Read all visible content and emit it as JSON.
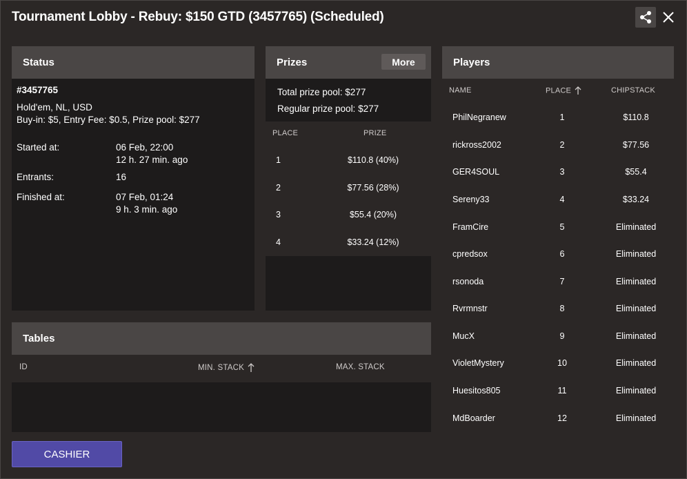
{
  "window": {
    "title": "Tournament Lobby - Rebuy: $150 GTD (3457765) (Scheduled)"
  },
  "icons": {
    "share": "share-icon",
    "close": "close-icon",
    "sort": "sort-arrow-up-icon"
  },
  "status": {
    "heading": "Status",
    "id": "#3457765",
    "game": "Hold'em, NL, USD",
    "buyin": "Buy-in: $5, Entry Fee: $0.5, Prize pool: $277",
    "started_label": "Started at:",
    "started_value": "06 Feb, 22:00",
    "started_ago": "12 h. 27 min. ago",
    "entrants_label": "Entrants:",
    "entrants_value": "16",
    "finished_label": "Finished at:",
    "finished_value": "07 Feb, 01:24",
    "finished_ago": "9 h. 3 min. ago"
  },
  "prizes": {
    "heading": "Prizes",
    "more_label": "More",
    "total_pool": "Total prize pool: $277",
    "regular_pool": "Regular prize pool: $277",
    "col_place": "PLACE",
    "col_prize": "PRIZE",
    "rows": [
      {
        "place": "1",
        "prize": "$110.8 (40%)"
      },
      {
        "place": "2",
        "prize": "$77.56 (28%)"
      },
      {
        "place": "3",
        "prize": "$55.4 (20%)"
      },
      {
        "place": "4",
        "prize": "$33.24 (12%)"
      }
    ]
  },
  "players": {
    "heading": "Players",
    "col_name": "NAME",
    "col_place": "PLACE",
    "col_chipstack": "CHIPSTACK",
    "rows": [
      {
        "name": "PhilNegranew",
        "place": "1",
        "chips": "$110.8"
      },
      {
        "name": "rickross2002",
        "place": "2",
        "chips": "$77.56"
      },
      {
        "name": "GER4SOUL",
        "place": "3",
        "chips": "$55.4"
      },
      {
        "name": "Sereny33",
        "place": "4",
        "chips": "$33.24"
      },
      {
        "name": "FramCire",
        "place": "5",
        "chips": "Eliminated"
      },
      {
        "name": "cpredsox",
        "place": "6",
        "chips": "Eliminated"
      },
      {
        "name": "rsonoda",
        "place": "7",
        "chips": "Eliminated"
      },
      {
        "name": "Rvrmnstr",
        "place": "8",
        "chips": "Eliminated"
      },
      {
        "name": "MucX",
        "place": "9",
        "chips": "Eliminated"
      },
      {
        "name": "VioletMystery",
        "place": "10",
        "chips": "Eliminated"
      },
      {
        "name": "Huesitos805",
        "place": "11",
        "chips": "Eliminated"
      },
      {
        "name": "MdBoarder",
        "place": "12",
        "chips": "Eliminated"
      }
    ]
  },
  "tables": {
    "heading": "Tables",
    "col_id": "ID",
    "col_min": "MIN. STACK",
    "col_max": "MAX. STACK"
  },
  "cashier_label": "CASHIER"
}
